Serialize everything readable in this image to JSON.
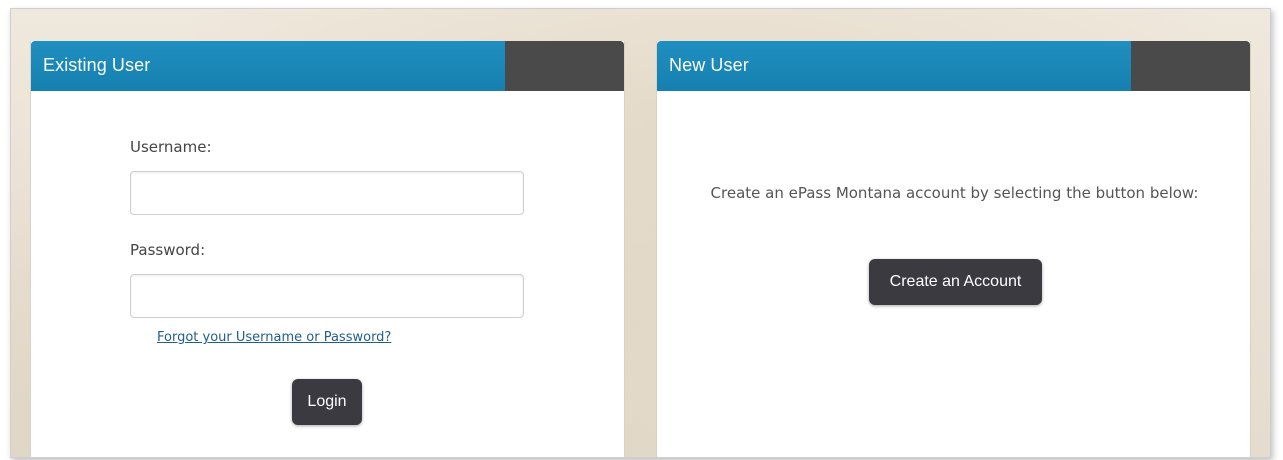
{
  "existing_user": {
    "header_title": "Existing User",
    "username_label": "Username:",
    "username_value": "",
    "password_label": "Password:",
    "password_value": "",
    "forgot_link": "Forgot your Username or Password?",
    "login_button": "Login"
  },
  "new_user": {
    "header_title": "New User",
    "description": "Create an ePass Montana account by selecting the button below:",
    "create_button": "Create an Account"
  },
  "colors": {
    "header_blue": "#1a88b8",
    "header_dark_tab": "#4a4a4a",
    "button_bg": "#3a3a40",
    "link": "#1f5f8b"
  }
}
